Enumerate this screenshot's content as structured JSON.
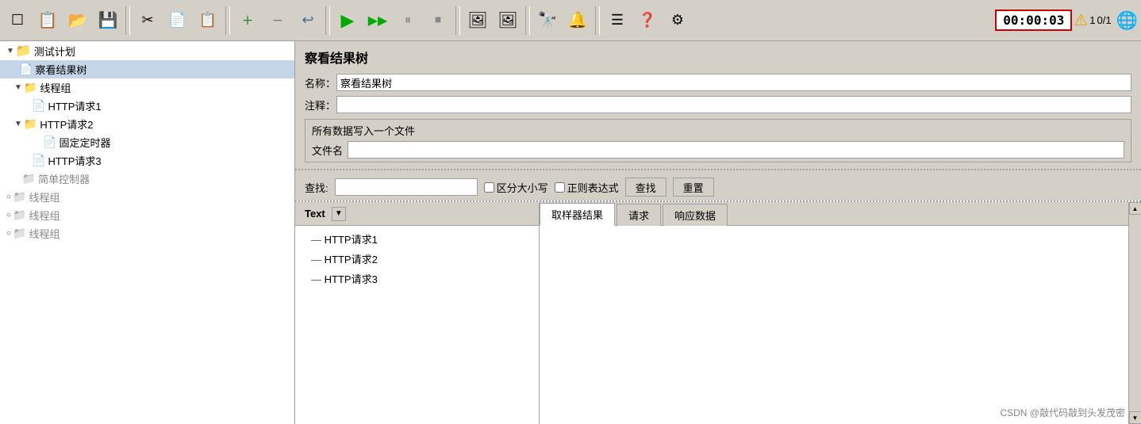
{
  "toolbar": {
    "buttons": [
      {
        "id": "new",
        "icon": "☐",
        "label": "新建"
      },
      {
        "id": "template",
        "icon": "📋",
        "label": "模板"
      },
      {
        "id": "open",
        "icon": "📂",
        "label": "打开"
      },
      {
        "id": "save",
        "icon": "💾",
        "label": "保存"
      },
      {
        "id": "cut",
        "icon": "✂",
        "label": "剪切"
      },
      {
        "id": "copy",
        "icon": "📄",
        "label": "复制"
      },
      {
        "id": "paste",
        "icon": "📋",
        "label": "粘贴"
      },
      {
        "id": "add",
        "icon": "+",
        "label": "添加"
      },
      {
        "id": "remove",
        "icon": "−",
        "label": "删除"
      },
      {
        "id": "undo",
        "icon": "↩",
        "label": "撤销"
      },
      {
        "id": "run",
        "icon": "▶",
        "label": "运行"
      },
      {
        "id": "run-all",
        "icon": "▶▶",
        "label": "全部运行"
      },
      {
        "id": "pause",
        "icon": "⏸",
        "label": "暂停"
      },
      {
        "id": "stop",
        "icon": "⏹",
        "label": "停止"
      },
      {
        "id": "img1",
        "icon": "🖼",
        "label": "图像1"
      },
      {
        "id": "img2",
        "icon": "🖼",
        "label": "图像2"
      },
      {
        "id": "search",
        "icon": "🔭",
        "label": "搜索"
      },
      {
        "id": "bell",
        "icon": "🔔",
        "label": "通知"
      },
      {
        "id": "list",
        "icon": "☰",
        "label": "列表"
      },
      {
        "id": "help",
        "icon": "❓",
        "label": "帮助"
      },
      {
        "id": "settings",
        "icon": "⚙",
        "label": "设置"
      }
    ],
    "timer": "00:00:03",
    "warn_count": "1",
    "progress": "0/1"
  },
  "tree": {
    "items": [
      {
        "id": "test-plan",
        "label": "测试计划",
        "indent": 0,
        "icon": "folder",
        "expanded": true,
        "selected": false
      },
      {
        "id": "view-tree",
        "label": "察看结果树",
        "indent": 1,
        "icon": "file",
        "expanded": false,
        "selected": true
      },
      {
        "id": "thread-group1",
        "label": "线程组",
        "indent": 1,
        "icon": "folder",
        "expanded": true,
        "selected": false
      },
      {
        "id": "http1",
        "label": "HTTP请求1",
        "indent": 2,
        "icon": "file",
        "expanded": false,
        "selected": false
      },
      {
        "id": "http2",
        "label": "HTTP请求2",
        "indent": 1,
        "icon": "folder",
        "expanded": true,
        "selected": false
      },
      {
        "id": "timer",
        "label": "固定定时器",
        "indent": 3,
        "icon": "file",
        "expanded": false,
        "selected": false
      },
      {
        "id": "http3",
        "label": "HTTP请求3",
        "indent": 2,
        "icon": "file",
        "expanded": false,
        "selected": false
      },
      {
        "id": "controller",
        "label": "简单控制器",
        "indent": 2,
        "icon": "folder-gray",
        "expanded": false,
        "selected": false
      },
      {
        "id": "thread-group2",
        "label": "线程组",
        "indent": 0,
        "icon": "folder-gray",
        "expanded": false,
        "selected": false
      },
      {
        "id": "thread-group3",
        "label": "线程组",
        "indent": 0,
        "icon": "folder-gray",
        "expanded": false,
        "selected": false
      },
      {
        "id": "thread-group4",
        "label": "线程组",
        "indent": 0,
        "icon": "folder-gray",
        "expanded": false,
        "selected": false
      }
    ]
  },
  "form": {
    "title": "察看结果树",
    "name_label": "名称：",
    "name_value": "察看结果树",
    "comment_label": "注释：",
    "comment_value": "",
    "section_title": "所有数据写入一个文件",
    "filename_label": "文件名",
    "filename_value": "",
    "search_label": "查找:",
    "search_value": "",
    "case_sensitive_label": "区分大小写",
    "regex_label": "正则表达式",
    "search_btn": "查找",
    "reset_btn": "重置"
  },
  "results": {
    "column_label": "Text",
    "items": [
      {
        "label": "HTTP请求1"
      },
      {
        "label": "HTTP请求2"
      },
      {
        "label": "HTTP请求3"
      }
    ],
    "tabs": [
      {
        "id": "sampler",
        "label": "取样器结果",
        "active": true
      },
      {
        "id": "request",
        "label": "请求",
        "active": false
      },
      {
        "id": "response",
        "label": "响应数据",
        "active": false
      }
    ]
  },
  "watermark": "CSDN @敲代码敲到头发茂密"
}
